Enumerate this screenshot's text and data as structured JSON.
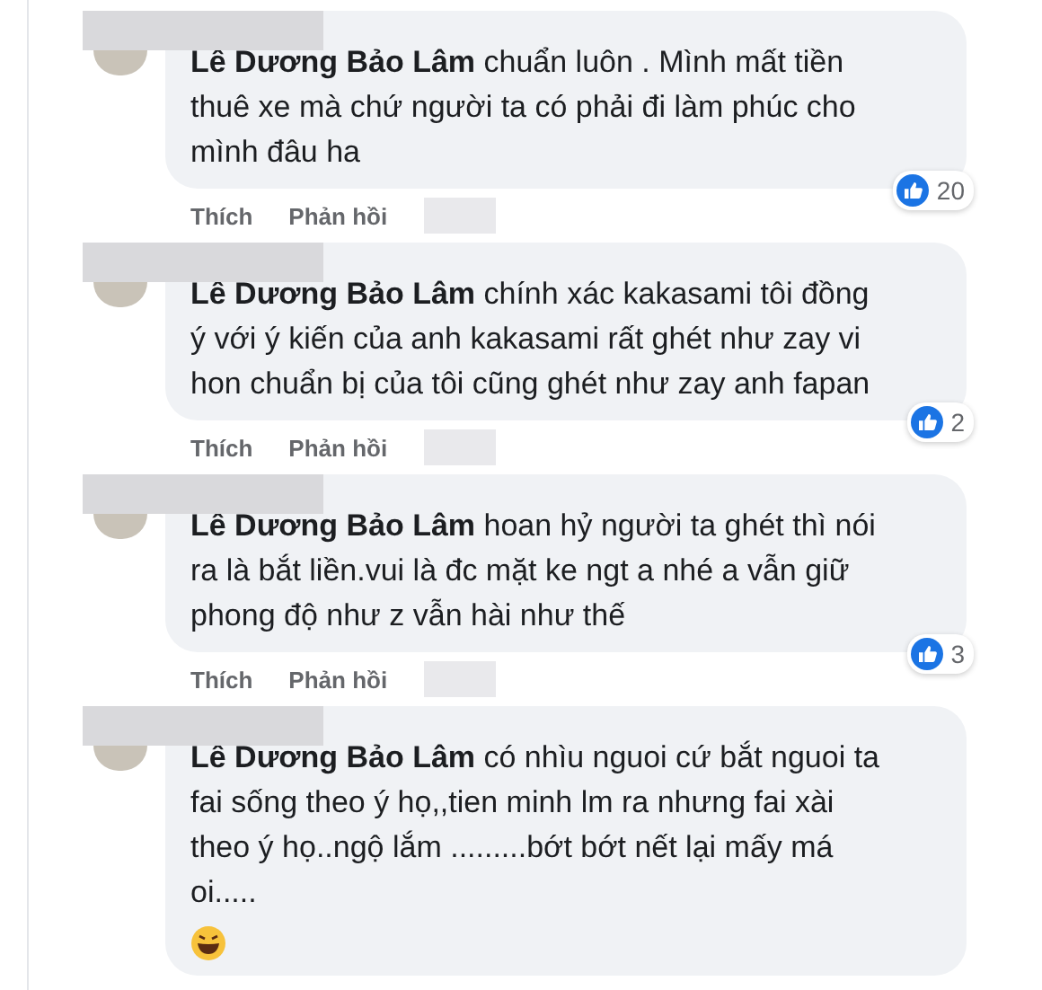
{
  "comments": [
    {
      "text": "**Lê Dương Bảo Lâm** chuẩn luôn . Mình mất tiền thuê xe mà chứ người ta có phải đi làm phúc cho mình đâu ha",
      "reaction": {
        "kind": "like",
        "count": "20"
      },
      "actions": [
        "Thích",
        "Phản hồi"
      ]
    },
    {
      "text": "**Lê Dương Bảo Lâm** chính xác kakasami tôi đồng ý với ý kiến của anh kakasami rất ghét như zay vi hon chuẩn bị của tôi cũng ghét như zay anh fapan",
      "reaction": {
        "kind": "like",
        "count": "2"
      },
      "actions": [
        "Thích",
        "Phản hồi"
      ]
    },
    {
      "text": "**Lê Dương Bảo Lâm** hoan hỷ người ta ghét thì nói ra là bắt liền.vui là đc mặt ke ngt a nhé a vẫn giữ phong độ như z vẫn hài như thế",
      "reaction": {
        "kind": "like",
        "count": "3"
      },
      "actions": [
        "Thích",
        "Phản hồi"
      ]
    },
    {
      "text": "**Lê Dương Bảo Lâm** có nhìu nguoi cứ bắt nguoi ta fai sống theo ý họ,,tien minh lm ra nhưng fai xài theo ý họ..ngộ lắm .........bớt bớt nết lại mấy má oi.....",
      "reaction": {
        "kind": "emoji"
      }
    }
  ]
}
